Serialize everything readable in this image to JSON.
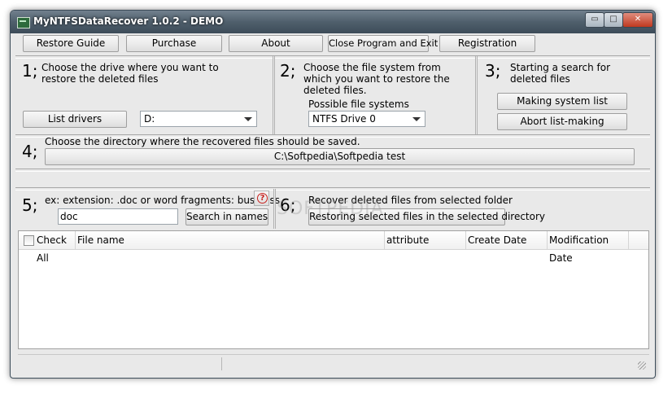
{
  "window": {
    "title": "MyNTFSDataRecover 1.0.2 - DEMO",
    "controls": {
      "minimize": "▭",
      "maximize": "□",
      "close": "✕"
    }
  },
  "toolbar": {
    "restore_guide": "Restore Guide",
    "purchase": "Purchase",
    "about": "About",
    "close_program": "Close Program and Exit",
    "registration": "Registration"
  },
  "step1": {
    "number": "1;",
    "text": "Choose the drive where you want to restore the deleted files",
    "list_drivers": "List drivers",
    "drive_selected": "D:"
  },
  "step2": {
    "number": "2;",
    "text": "Choose the file system from which you want to restore the deleted files.",
    "possible_label": "Possible file systems",
    "fs_selected": "NTFS Drive 0"
  },
  "step3": {
    "number": "3;",
    "text": "Starting a search for deleted files",
    "making_list": "Making system list",
    "abort_list": "Abort list-making"
  },
  "step4": {
    "number": "4;",
    "text": "Choose the directory where the recovered files should be saved.",
    "directory": "C:\\Softpedia\\Softpedia test"
  },
  "step5": {
    "number": "5;",
    "text": "ex: extension: .doc or word fragments: business",
    "search_value": "doc",
    "search_button": "Search in names",
    "help_icon": "question-circle"
  },
  "step6": {
    "number": "6;",
    "text": "Recover deleted files from selected folder",
    "restore_button": "Restoring selected files in the selected directory"
  },
  "file_list": {
    "check_all": "Check All",
    "columns": [
      "File name",
      "attribute",
      "Create Date",
      "Modification Date"
    ]
  },
  "watermark": "SOFTPEDIA",
  "colors": {
    "help_red": "#c8201d",
    "title_bar": "#4f5f6c"
  }
}
